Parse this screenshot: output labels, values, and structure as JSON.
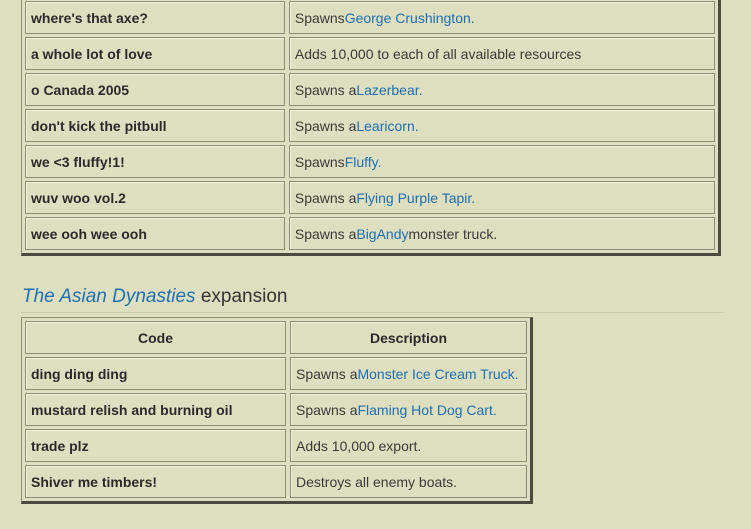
{
  "table1": {
    "rows": [
      {
        "code": "where's that axe?",
        "prefix": "Spawns ",
        "link": "George Crushington.",
        "suffix": ""
      },
      {
        "code": "a whole lot of love",
        "prefix": "Adds 10,000 to each of all available resources",
        "link": "",
        "suffix": ""
      },
      {
        "code": "o Canada 2005",
        "prefix": "Spawns a ",
        "link": "Lazerbear.",
        "suffix": ""
      },
      {
        "code": "don't kick the pitbull",
        "prefix": "Spawns a ",
        "link": "Learicorn.",
        "suffix": ""
      },
      {
        "code": "we <3 fluffy!1!",
        "prefix": "Spawns ",
        "link": "Fluffy.",
        "suffix": ""
      },
      {
        "code": "wuv woo vol.2",
        "prefix": "Spawns a ",
        "link": "Flying Purple Tapir.",
        "suffix": ""
      },
      {
        "code": "wee ooh wee ooh",
        "prefix": "Spawns a ",
        "link": "BigAndy",
        "suffix": " monster truck."
      }
    ]
  },
  "section": {
    "link": "The Asian Dynasties",
    "rest": " expansion"
  },
  "table2": {
    "header": {
      "code": "Code",
      "description": "Description"
    },
    "rows": [
      {
        "code": "ding ding ding",
        "prefix": "Spawns a ",
        "link": "Monster Ice Cream Truck.",
        "suffix": ""
      },
      {
        "code": "mustard relish and burning oil",
        "prefix": "Spawns a ",
        "link": "Flaming Hot Dog Cart.",
        "suffix": ""
      },
      {
        "code": "trade plz",
        "prefix": "Adds 10,000 export.",
        "link": "",
        "suffix": ""
      },
      {
        "code": "Shiver me timbers!",
        "prefix": "Destroys all enemy boats.",
        "link": "",
        "suffix": ""
      }
    ]
  },
  "colors": {
    "background": "#dedfc0",
    "link": "#1f6fb2"
  }
}
